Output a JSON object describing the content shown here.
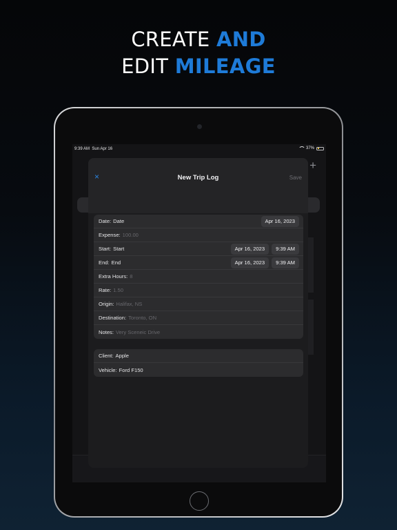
{
  "headline": {
    "line1_plain": "CREATE ",
    "line1_accent": "AND",
    "line2_plain": "EDIT ",
    "line2_accent": "MILEAGE"
  },
  "status_bar": {
    "time": "9:39 AM",
    "date": "Sun Apr 16",
    "battery": "37%"
  },
  "colors": {
    "accent": "#1e7bd8",
    "battery": "#e8c541"
  },
  "background_app": {
    "add_icon": "+"
  },
  "sheet": {
    "close_icon": "×",
    "title": "New Trip Log",
    "save_label": "Save"
  },
  "form": {
    "date": {
      "label": "Date:",
      "value": "Date",
      "picker": "Apr 16, 2023"
    },
    "expense": {
      "label": "Expense:",
      "placeholder": "100.00"
    },
    "start": {
      "label": "Start:",
      "value": "Start",
      "date": "Apr 16, 2023",
      "time": "9:39 AM"
    },
    "end": {
      "label": "End:",
      "value": "End",
      "date": "Apr 16, 2023",
      "time": "9:39 AM"
    },
    "extra_hours": {
      "label": "Extra Hours:",
      "placeholder": "8"
    },
    "rate": {
      "label": "Rate:",
      "placeholder": "1.50"
    },
    "origin": {
      "label": "Origin:",
      "placeholder": "Halifax, NS"
    },
    "destination": {
      "label": "Destination:",
      "placeholder": "Toronto, ON"
    },
    "notes": {
      "label": "Notes:",
      "placeholder": "Very Sceneic Drive"
    },
    "client": {
      "label": "Client:",
      "value": "Apple"
    },
    "vehicle": {
      "label": "Vehicle:",
      "value": "Ford F150"
    }
  }
}
